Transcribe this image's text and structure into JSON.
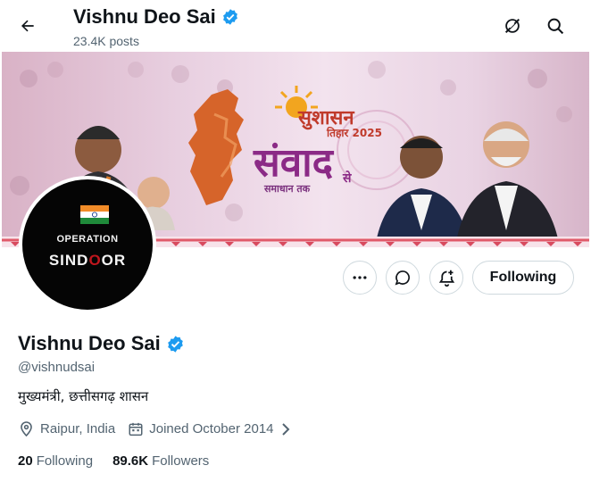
{
  "header": {
    "back_icon": "arrow-left-icon",
    "name": "Vishnu Deo Sai",
    "posts": "23.4K posts",
    "right_icons": [
      "grok-icon",
      "search-icon"
    ]
  },
  "banner": {
    "sushasan": "सुशासन",
    "tihar": "तिहार 2025",
    "samvad": "संवाद",
    "se": "से",
    "samadhan": "समाधान तक"
  },
  "avatar": {
    "line1": "OPERATION",
    "line2_a": "SIND",
    "line2_b": "O",
    "line2_c": "OR"
  },
  "actions": {
    "more_icon": "more-icon",
    "message_icon": "message-icon",
    "subscribe_icon": "notification-add-icon",
    "following_label": "Following"
  },
  "profile": {
    "name": "Vishnu Deo Sai",
    "verified": true,
    "handle": "@vishnudsai",
    "bio": "मुख्यमंत्री, छत्तीसगढ़ शासन",
    "location": "Raipur, India",
    "joined": "Joined October 2014",
    "following_count": "20",
    "following_label": "Following",
    "followers_count": "89.6K",
    "followers_label": "Followers"
  },
  "colors": {
    "verified": "#1d9bf0",
    "text": "#0f1419",
    "muted": "#536471",
    "border": "#cfd9de"
  }
}
